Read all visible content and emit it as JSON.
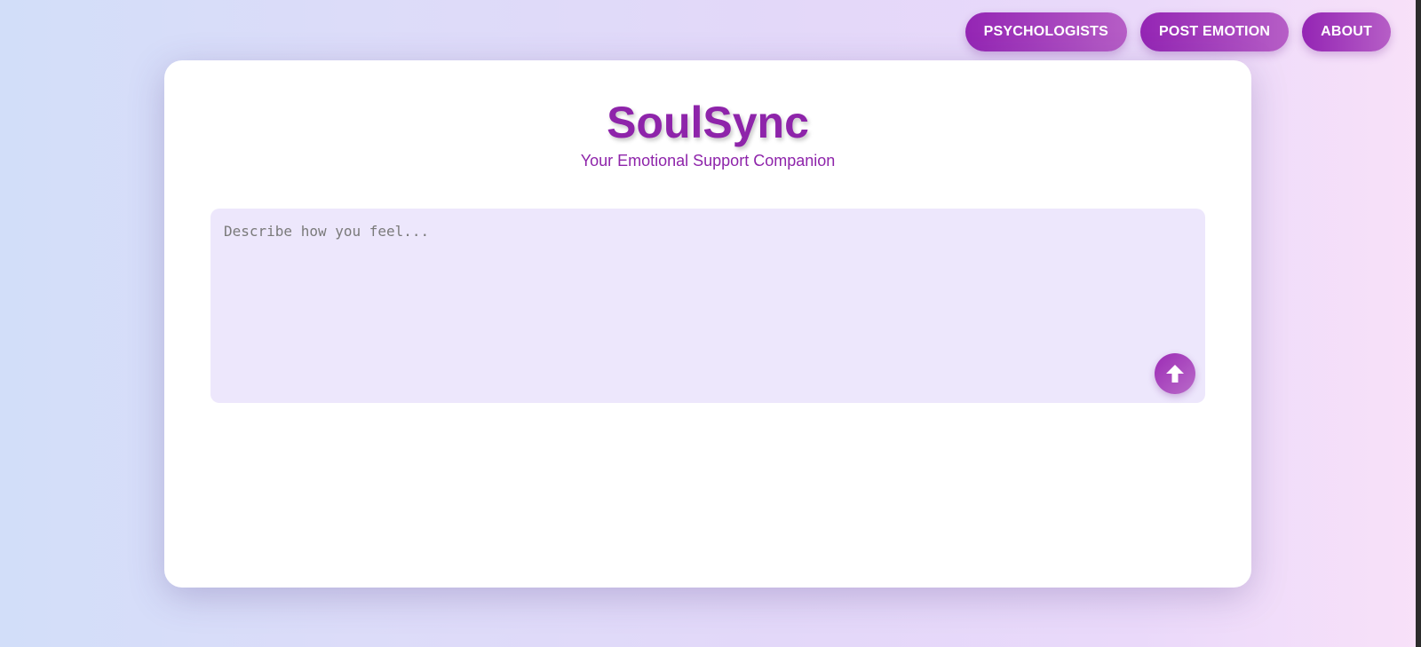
{
  "nav": {
    "items": [
      {
        "label": "PSYCHOLOGISTS"
      },
      {
        "label": "POST EMOTION"
      },
      {
        "label": "ABOUT"
      }
    ]
  },
  "header": {
    "title": "SoulSync",
    "subtitle": "Your Emotional Support Companion"
  },
  "input": {
    "value": "",
    "placeholder": "Describe how you feel..."
  },
  "send": {
    "icon": "arrow-up-icon"
  },
  "colors": {
    "accent": "#8e24aa",
    "button_gradient_start": "#9425b4",
    "button_gradient_end": "#b65ec6",
    "input_background": "#ede7fc"
  }
}
